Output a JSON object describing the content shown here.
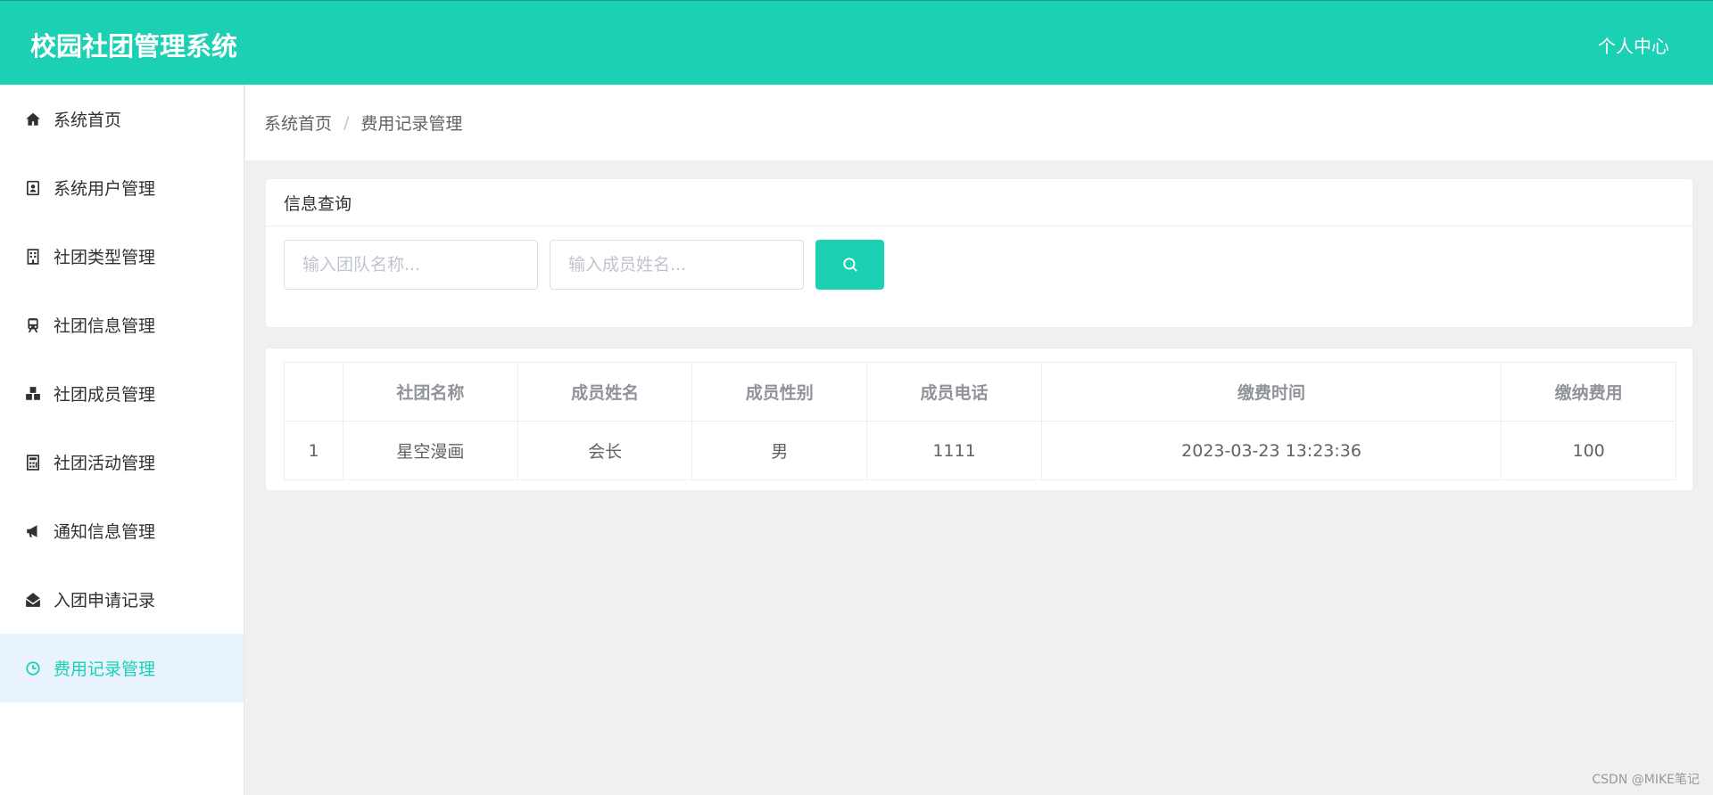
{
  "header": {
    "app_title": "校园社团管理系统",
    "user_center": "个人中心"
  },
  "sidebar": {
    "items": [
      {
        "label": "系统首页",
        "icon": "home-icon"
      },
      {
        "label": "系统用户管理",
        "icon": "contact-card-icon"
      },
      {
        "label": "社团类型管理",
        "icon": "building-icon"
      },
      {
        "label": "社团信息管理",
        "icon": "train-icon"
      },
      {
        "label": "社团成员管理",
        "icon": "cubes-icon"
      },
      {
        "label": "社团活动管理",
        "icon": "calculator-icon"
      },
      {
        "label": "通知信息管理",
        "icon": "megaphone-icon"
      },
      {
        "label": "入团申请记录",
        "icon": "envelope-open-icon"
      },
      {
        "label": "费用记录管理",
        "icon": "clock-icon",
        "active": true
      }
    ]
  },
  "breadcrumb": {
    "home": "系统首页",
    "separator": "/",
    "current": "费用记录管理"
  },
  "query": {
    "title": "信息查询",
    "team_placeholder": "输入团队名称...",
    "member_placeholder": "输入成员姓名...",
    "search_icon": "search-icon"
  },
  "table": {
    "headers": [
      "",
      "社团名称",
      "成员姓名",
      "成员性别",
      "成员电话",
      "缴费时间",
      "缴纳费用"
    ],
    "rows": [
      [
        "1",
        "星空漫画",
        "会长",
        "男",
        "1111",
        "2023-03-23 13:23:36",
        "100"
      ]
    ]
  },
  "watermark": "CSDN @MIKE笔记",
  "colors": {
    "accent": "#1cd0b3",
    "active_menu_bg": "#e8f3fe"
  }
}
